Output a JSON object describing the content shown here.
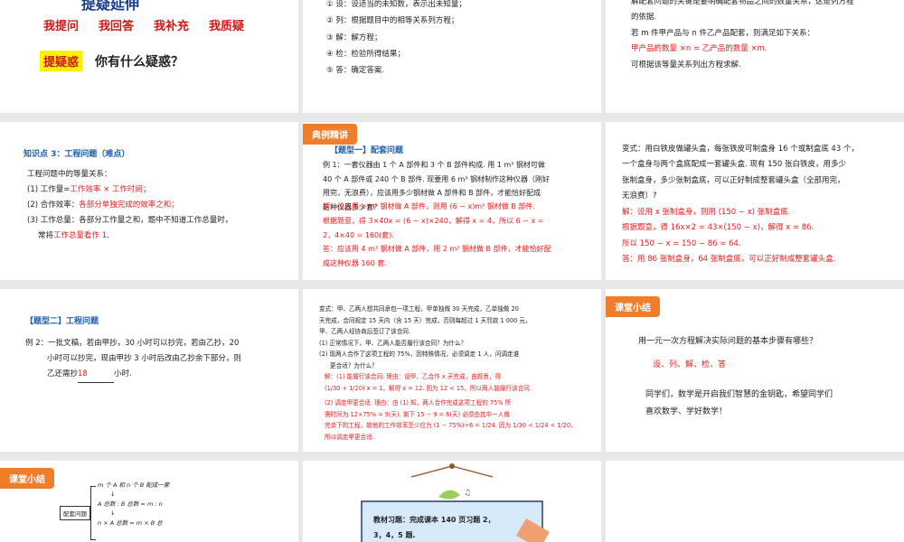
{
  "s1": {
    "title_partial": "提疑延伸",
    "asks": [
      "我提问",
      "我回答",
      "我补充",
      "我质疑"
    ],
    "badge": "提疑惑",
    "question": "你有什么疑惑？"
  },
  "s2": {
    "steps": [
      "① 设：设适当的未知数，表示出未知量；",
      "② 列：根据题目中的相等关系列方程；",
      "③ 解：解方程；",
      "④ 检：检验所得结果；",
      "⑤ 答：确定答案."
    ]
  },
  "s3": {
    "l1": "解配套问题的关键是要明确配套物品之间的数量关系，这是列方程",
    "l2": "的依据.",
    "l3": "若 m 件甲产品与 n 件乙产品配套，则满足如下关系：",
    "l4": "甲产品的数量 ×n = 乙产品的数量 ×m.",
    "l5": "可根据该等量关系列出方程求解."
  },
  "s4": {
    "heading": "知识点 3：工程问题（难点）",
    "intro": "工程问题中的等量关系：",
    "p1a": "(1) 工作量=",
    "p1b": "工作效率 × 工作时间；",
    "p2a": "(2) 合作效率：",
    "p2b": "各部分单独完成的效率之和；",
    "p3a": "(3) 工作总量：各部分工作量之和，题中不知道工作总量时，",
    "p3b": "常将",
    "p3c": "工作总量看作 1",
    "p3d": "."
  },
  "s5": {
    "tag": "典例精讲",
    "type": "【题型一】配套问题",
    "q1": "例 1：一套仪器由 1 个 A 部件和 3 个 B 部件构成. 用 1 m³ 钢材可做",
    "q2": "40 个 A 部件或 240 个 B 部件. 现要用 6 m³ 钢材制作这种仪器（刚好",
    "q3": "用完，无浪费），应该用多少钢材做 A 部件和 B 部件，才能恰好配成",
    "q4": "这种仪器多少套？",
    "a1": "解：设应用 x m³ 钢材做 A 部件，则用 (6 − x)m³ 钢材做 B 部件.",
    "a2": "根据题意，得 3×40x = (6 − x)×240，解得 x = 4，所以 6 − x =",
    "a3": "2，4×40 = 160(套).",
    "a4": "答：应该用 4 m³ 钢材做 A 部件，用 2 m³ 钢材做 B 部件，才能恰好配",
    "a5": "成这种仪器 160 套."
  },
  "s6": {
    "q1": "变式：用白铁皮做罐头盒，每张铁皮可制盒身 16 个或制盒底 43 个，",
    "q2": "一个盒身与两个盒底配成一套罐头盒. 现有 150 张白铁皮，用多少",
    "q3": "张制盒身，多少张制盒底，可以正好制成整套罐头盒（全部用完，",
    "q4": "无浪费）?",
    "a1": "解：设用 x 张制盒身，则用 (150 − x) 张制盒底.",
    "a2": "根据题意，得 16x×2 = 43×(150 − x)，解得 x = 86.",
    "a3": "所以 150 − x = 150 − 86 = 64.",
    "a4": "答：用 86 张制盒身，64 张制盒底，可以正好制成整套罐头盒."
  },
  "s7": {
    "type": "【题型二】工程问题",
    "q1": "例 2：一批文稿，若由甲抄，30 小时可以抄完，若由乙抄，20",
    "q2": "小时可以抄完，现由甲抄 3 小时后改由乙抄余下部分，则",
    "q3a": "乙还需抄",
    "blank": "18",
    "q3b": "小时."
  },
  "s8": {
    "l1": "变式：甲、乙两人想共同承包一项工程，甲单独做 30 天完成，乙单独做 20",
    "l2": "天完成，合同规定 15 天内（含 15 天）完成，否则每超过 1 天罚款 1 000 元，",
    "l3": "甲、乙两人经协商后签订了该合同.",
    "l4": "(1) 正常情况下，甲、乙两人能否履行该合同？为什么？",
    "l5": "(2) 现两人合作了这项工程的 75%，因特殊情况，必须调走 1 人，问调走谁",
    "l6": "更合适？为什么？",
    "a1": "解：(1) 能履行该合同. 理由：设甲、乙合作 x 天完成，由题意，得",
    "a2": "(1/30 + 1/20) x = 1，解得 x = 12. 因为 12 < 15，所以两人能履行该合同.",
    "a3": "(2) 调走甲更合适. 理由：由 (1) 知，两人合作完成这项工程的 75% 所",
    "a4": "需时间为 12×75% = 9(天). 剩下 15 − 9 = 6(天) 必须由其中一人做",
    "a5": "完余下的工程，故他的工作效率至少应为 (1 − 75%)÷6 = 1/24. 因为 1/30 < 1/24 < 1/20，",
    "a6": "所以调走甲更合适."
  },
  "s9": {
    "tag": "课堂小结",
    "q": "用一元一次方程解决实际问题的基本步骤有哪些？",
    "a": "设、列、解、检、答",
    "e1": "同学们，数学是开启我们智慧的金钥匙，希望同学们",
    "e2": "喜欢数学、学好数学！"
  },
  "s10": {
    "tag": "课堂小结",
    "box": "配套问题",
    "f1": "m 个 A 和 n 个 B 配成一套",
    "f2": "A 总数 : B 总数 = m : n",
    "f3": "n × A 总数 = m × B 总"
  },
  "s11": {
    "hw1": "教材习题：完成课本 140 页习题 2，",
    "hw2": "3，4，5 题."
  },
  "colors": {
    "accent": "#ef7d2a",
    "red": "#e02020",
    "blue": "#1d5fb0"
  }
}
